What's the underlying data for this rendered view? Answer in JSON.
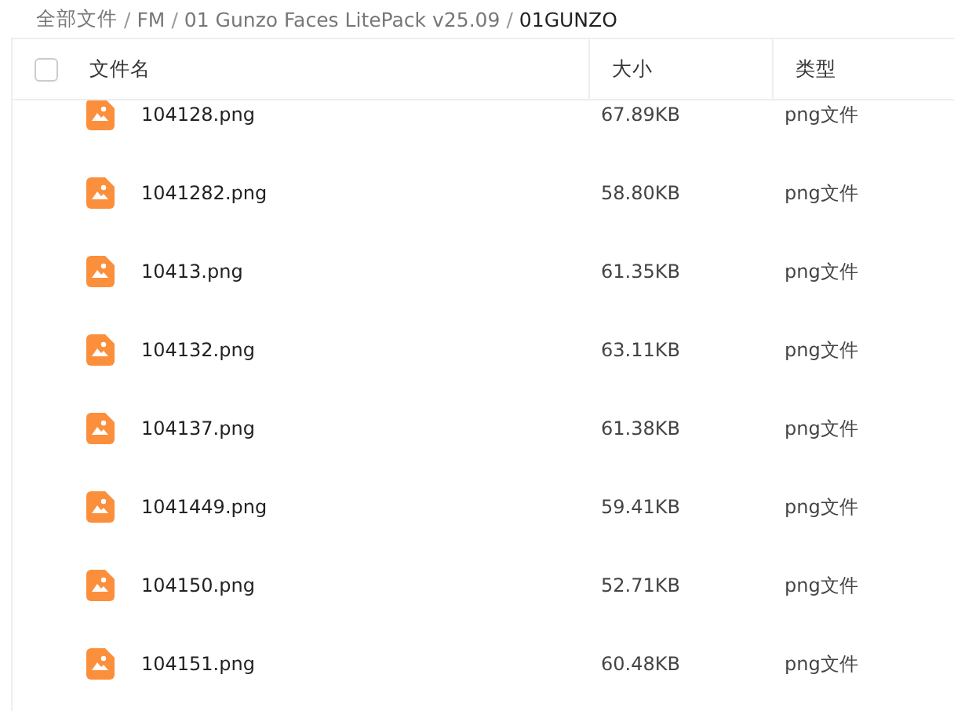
{
  "breadcrumb_separator": "/",
  "breadcrumb": [
    {
      "label": "全部文件",
      "current": false
    },
    {
      "label": "FM",
      "current": false
    },
    {
      "label": "01 Gunzo Faces LitePack v25.09",
      "current": false
    },
    {
      "label": "01GUNZO",
      "current": true
    }
  ],
  "table": {
    "select_all": {
      "checked": false
    },
    "columns": [
      "文件名",
      "大小",
      "类型"
    ],
    "rows": [
      {
        "name": "104128.png",
        "size": "67.89KB",
        "type": "png文件"
      },
      {
        "name": "1041282.png",
        "size": "58.80KB",
        "type": "png文件"
      },
      {
        "name": "10413.png",
        "size": "61.35KB",
        "type": "png文件"
      },
      {
        "name": "104132.png",
        "size": "63.11KB",
        "type": "png文件"
      },
      {
        "name": "104137.png",
        "size": "61.38KB",
        "type": "png文件"
      },
      {
        "name": "1041449.png",
        "size": "59.41KB",
        "type": "png文件"
      },
      {
        "name": "104150.png",
        "size": "52.71KB",
        "type": "png文件"
      },
      {
        "name": "104151.png",
        "size": "60.48KB",
        "type": "png文件"
      }
    ]
  }
}
